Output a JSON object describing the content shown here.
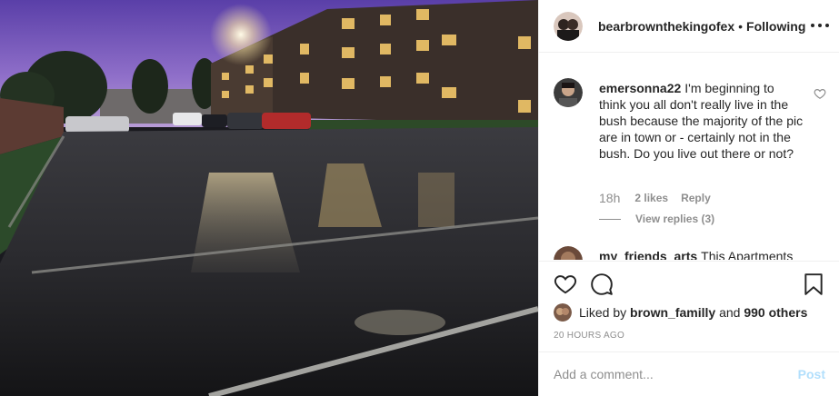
{
  "header": {
    "username": "bearbrownthekingofex",
    "separator": "•",
    "follow_state": "Following",
    "more_icon": "more-horizontal-icon"
  },
  "comments": [
    {
      "username": "emersonna22",
      "text": "I'm beginning to think you all don't really live in the bush because the majority of the pic are in town or - certainly not in the bush. Do you live out there or not?",
      "time": "18h",
      "likes": "2 likes",
      "reply_label": "Reply",
      "view_replies": "View replies (3)"
    },
    {
      "username": "my_friends_arts",
      "text": "This Apartments"
    }
  ],
  "actions": {
    "like_icon": "heart-icon",
    "comment_icon": "comment-icon",
    "save_icon": "bookmark-icon"
  },
  "likes": {
    "prefix": "Liked by",
    "user": "brown_familly",
    "conjunction": "and",
    "others": "990 others"
  },
  "timestamp": "20 HOURS AGO",
  "add_comment": {
    "placeholder": "Add a comment...",
    "post_label": "Post"
  },
  "colors": {
    "text": "#262626",
    "muted": "#8e8e8e",
    "post_disabled": "#b2dffc",
    "border": "#efefef"
  }
}
